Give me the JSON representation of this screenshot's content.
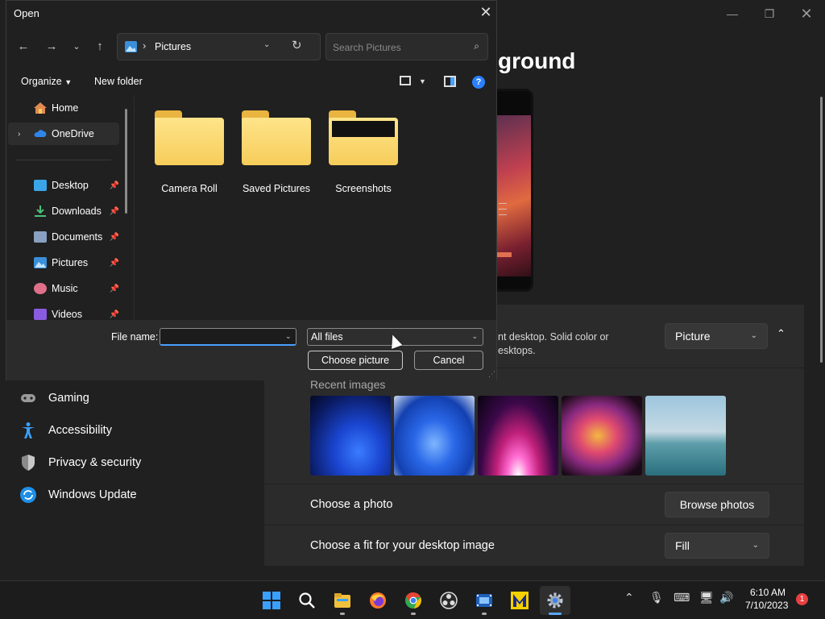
{
  "dialog": {
    "title": "Open",
    "address": "Pictures",
    "search_placeholder": "Search Pictures",
    "toolbar": {
      "organize": "Organize",
      "new_folder": "New folder"
    },
    "nav": {
      "home": "Home",
      "onedrive": "OneDrive",
      "desktop": "Desktop",
      "downloads": "Downloads",
      "documents": "Documents",
      "pictures": "Pictures",
      "music": "Music",
      "videos": "Videos"
    },
    "folders": [
      "Camera Roll",
      "Saved Pictures",
      "Screenshots"
    ],
    "filename_label": "File name:",
    "filename_value": "",
    "filetype": "All files",
    "choose_button": "Choose picture",
    "cancel_button": "Cancel"
  },
  "settings": {
    "heading": "ground",
    "personalize_desc": "nt desktop. Solid color or\nesktops.",
    "background_type": "Picture",
    "recent_images_label": "Recent images",
    "choose_photo_label": "Choose a photo",
    "browse_button": "Browse photos",
    "fit_label": "Choose a fit for your desktop image",
    "fit_value": "Fill",
    "sidebar": {
      "gaming": "Gaming",
      "accessibility": "Accessibility",
      "privacy": "Privacy & security",
      "update": "Windows Update"
    }
  },
  "taskbar": {
    "time": "6:10 AM",
    "date": "7/10/2023",
    "notifications": "1"
  },
  "colors": {
    "accent": "#4aa0ff",
    "folder": "#f6cd5a",
    "background": "#202020",
    "badge": "#e84040"
  }
}
